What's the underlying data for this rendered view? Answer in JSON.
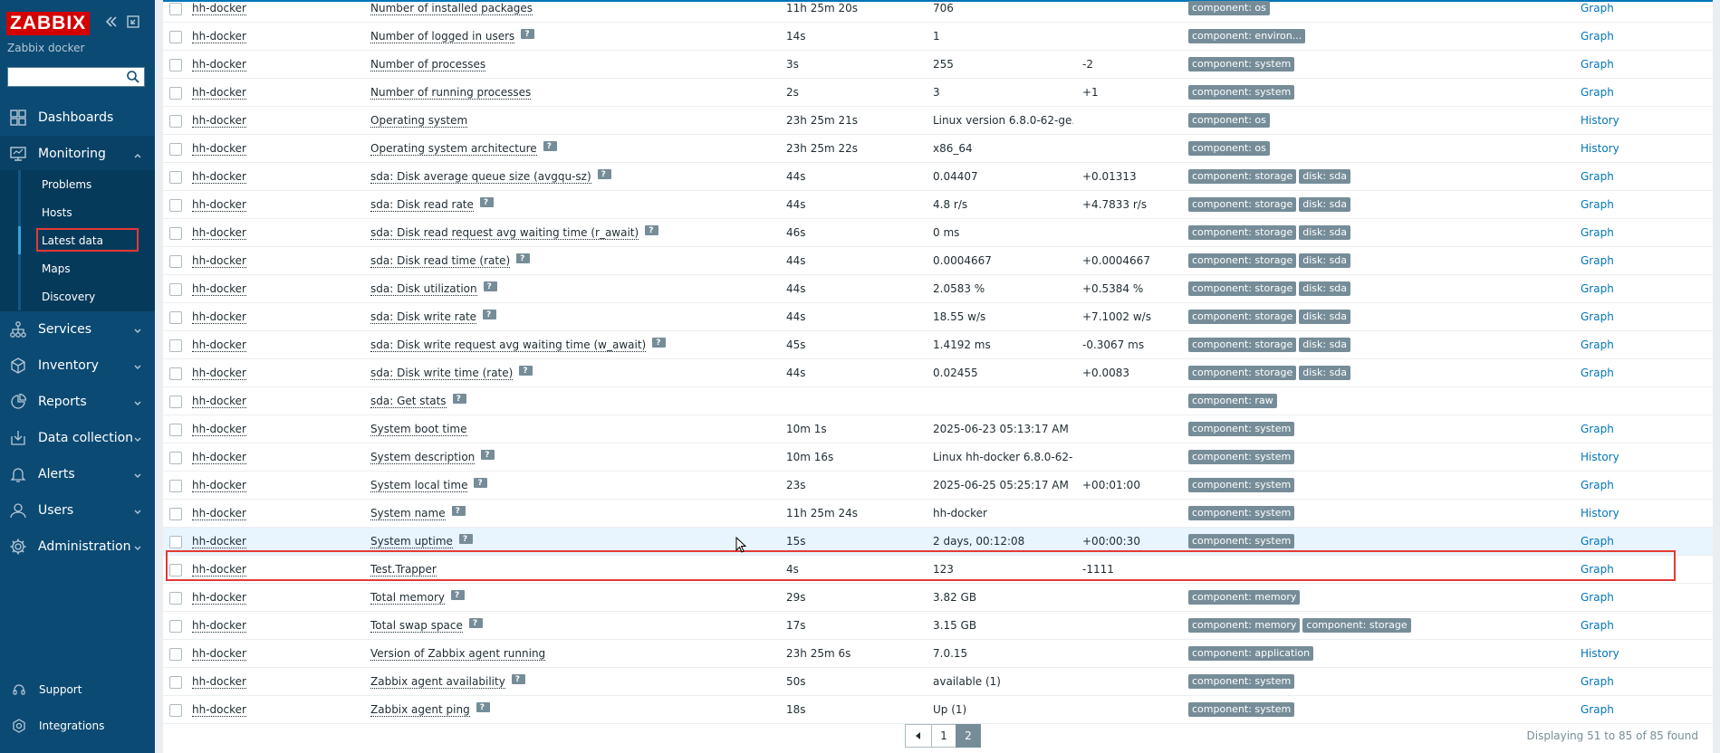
{
  "sidebar": {
    "logo": "ZABBIX",
    "subtitle": "Zabbix docker",
    "search_placeholder": "",
    "nav": [
      {
        "label": "Dashboards",
        "icon": "dashboards-icon"
      },
      {
        "label": "Monitoring",
        "icon": "monitoring-icon"
      },
      {
        "label": "Services",
        "icon": "services-icon"
      },
      {
        "label": "Inventory",
        "icon": "inventory-icon"
      },
      {
        "label": "Reports",
        "icon": "reports-icon"
      },
      {
        "label": "Data collection",
        "icon": "data-collection-icon"
      },
      {
        "label": "Alerts",
        "icon": "alerts-icon"
      },
      {
        "label": "Users",
        "icon": "users-icon"
      },
      {
        "label": "Administration",
        "icon": "administration-icon"
      }
    ],
    "monitoring_sub": [
      "Problems",
      "Hosts",
      "Latest data",
      "Maps",
      "Discovery"
    ],
    "bottom": [
      {
        "label": "Support",
        "icon": "support-icon"
      },
      {
        "label": "Integrations",
        "icon": "integrations-icon"
      }
    ]
  },
  "table": {
    "rows": [
      {
        "host": "hh-docker",
        "name": "Number of installed packages",
        "help": false,
        "check": "11h 25m 20s",
        "value": "706",
        "change": "",
        "tags": [
          "component: os"
        ],
        "action": "Graph"
      },
      {
        "host": "hh-docker",
        "name": "Number of logged in users",
        "help": true,
        "check": "14s",
        "value": "1",
        "change": "",
        "tags": [
          "component: environ..."
        ],
        "action": "Graph"
      },
      {
        "host": "hh-docker",
        "name": "Number of processes",
        "help": false,
        "check": "3s",
        "value": "255",
        "change": "-2",
        "tags": [
          "component: system"
        ],
        "action": "Graph"
      },
      {
        "host": "hh-docker",
        "name": "Number of running processes",
        "help": false,
        "check": "2s",
        "value": "3",
        "change": "+1",
        "tags": [
          "component: system"
        ],
        "action": "Graph"
      },
      {
        "host": "hh-docker",
        "name": "Operating system",
        "help": false,
        "check": "23h 25m 21s",
        "value": "Linux version 6.8.0-62-ge...",
        "change": "",
        "tags": [
          "component: os"
        ],
        "action": "History"
      },
      {
        "host": "hh-docker",
        "name": "Operating system architecture",
        "help": true,
        "check": "23h 25m 22s",
        "value": "x86_64",
        "change": "",
        "tags": [
          "component: os"
        ],
        "action": "History"
      },
      {
        "host": "hh-docker",
        "name": "sda: Disk average queue size (avgqu-sz)",
        "help": true,
        "check": "44s",
        "value": "0.04407",
        "change": "+0.01313",
        "tags": [
          "component: storage",
          "disk: sda"
        ],
        "action": "Graph"
      },
      {
        "host": "hh-docker",
        "name": "sda: Disk read rate",
        "help": true,
        "check": "44s",
        "value": "4.8 r/s",
        "change": "+4.7833 r/s",
        "tags": [
          "component: storage",
          "disk: sda"
        ],
        "action": "Graph"
      },
      {
        "host": "hh-docker",
        "name": "sda: Disk read request avg waiting time (r_await)",
        "help": true,
        "check": "46s",
        "value": "0 ms",
        "change": "",
        "tags": [
          "component: storage",
          "disk: sda"
        ],
        "action": "Graph"
      },
      {
        "host": "hh-docker",
        "name": "sda: Disk read time (rate)",
        "help": true,
        "check": "44s",
        "value": "0.0004667",
        "change": "+0.0004667",
        "tags": [
          "component: storage",
          "disk: sda"
        ],
        "action": "Graph"
      },
      {
        "host": "hh-docker",
        "name": "sda: Disk utilization",
        "help": true,
        "check": "44s",
        "value": "2.0583 %",
        "change": "+0.5384 %",
        "tags": [
          "component: storage",
          "disk: sda"
        ],
        "action": "Graph"
      },
      {
        "host": "hh-docker",
        "name": "sda: Disk write rate",
        "help": true,
        "check": "44s",
        "value": "18.55 w/s",
        "change": "+7.1002 w/s",
        "tags": [
          "component: storage",
          "disk: sda"
        ],
        "action": "Graph"
      },
      {
        "host": "hh-docker",
        "name": "sda: Disk write request avg waiting time (w_await)",
        "help": true,
        "check": "45s",
        "value": "1.4192 ms",
        "change": "-0.3067 ms",
        "tags": [
          "component: storage",
          "disk: sda"
        ],
        "action": "Graph"
      },
      {
        "host": "hh-docker",
        "name": "sda: Disk write time (rate)",
        "help": true,
        "check": "44s",
        "value": "0.02455",
        "change": "+0.0083",
        "tags": [
          "component: storage",
          "disk: sda"
        ],
        "action": "Graph"
      },
      {
        "host": "hh-docker",
        "name": "sda: Get stats",
        "help": true,
        "check": "",
        "value": "",
        "change": "",
        "tags": [
          "component: raw"
        ],
        "action": ""
      },
      {
        "host": "hh-docker",
        "name": "System boot time",
        "help": false,
        "check": "10m 1s",
        "value": "2025-06-23 05:13:17 AM",
        "change": "",
        "tags": [
          "component: system"
        ],
        "action": "Graph"
      },
      {
        "host": "hh-docker",
        "name": "System description",
        "help": true,
        "check": "10m 16s",
        "value": "Linux hh-docker 6.8.0-62-...",
        "change": "",
        "tags": [
          "component: system"
        ],
        "action": "History"
      },
      {
        "host": "hh-docker",
        "name": "System local time",
        "help": true,
        "check": "23s",
        "value": "2025-06-25 05:25:17 AM",
        "change": "+00:01:00",
        "tags": [
          "component: system"
        ],
        "action": "Graph"
      },
      {
        "host": "hh-docker",
        "name": "System name",
        "help": true,
        "check": "11h 25m 24s",
        "value": "hh-docker",
        "change": "",
        "tags": [
          "component: system"
        ],
        "action": "History"
      },
      {
        "host": "hh-docker",
        "name": "System uptime",
        "help": true,
        "check": "15s",
        "value": "2 days, 00:12:08",
        "change": "+00:00:30",
        "tags": [
          "component: system"
        ],
        "action": "Graph"
      },
      {
        "host": "hh-docker",
        "name": "Test.Trapper",
        "help": false,
        "check": "4s",
        "value": "123",
        "change": "-1111",
        "tags": [],
        "action": "Graph"
      },
      {
        "host": "hh-docker",
        "name": "Total memory",
        "help": true,
        "check": "29s",
        "value": "3.82 GB",
        "change": "",
        "tags": [
          "component: memory"
        ],
        "action": "Graph"
      },
      {
        "host": "hh-docker",
        "name": "Total swap space",
        "help": true,
        "check": "17s",
        "value": "3.15 GB",
        "change": "",
        "tags": [
          "component: memory",
          "component: storage"
        ],
        "action": "Graph"
      },
      {
        "host": "hh-docker",
        "name": "Version of Zabbix agent running",
        "help": false,
        "check": "23h 25m 6s",
        "value": "7.0.15",
        "change": "",
        "tags": [
          "component: application"
        ],
        "action": "History"
      },
      {
        "host": "hh-docker",
        "name": "Zabbix agent availability",
        "help": true,
        "check": "50s",
        "value": "available (1)",
        "change": "",
        "tags": [
          "component: system"
        ],
        "action": "Graph"
      },
      {
        "host": "hh-docker",
        "name": "Zabbix agent ping",
        "help": true,
        "check": "18s",
        "value": "Up (1)",
        "change": "",
        "tags": [
          "component: system"
        ],
        "action": "Graph"
      }
    ]
  },
  "pagination": {
    "pages": [
      "1",
      "2"
    ],
    "current": "2",
    "info": "Displaying 51 to 85 of 85 found"
  }
}
